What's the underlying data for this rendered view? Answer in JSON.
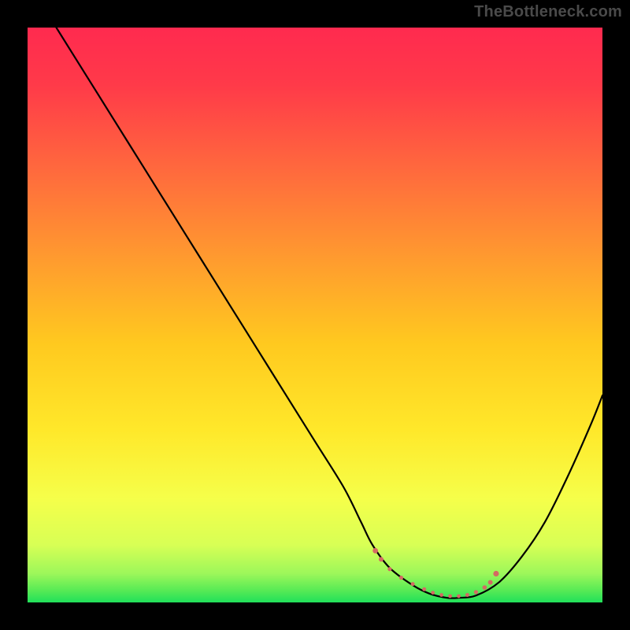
{
  "attribution": "TheBottleneck.com",
  "colors": {
    "frame_bg": "#000000",
    "gradient_top": "#ff2a4f",
    "gradient_mid": "#ffd400",
    "gradient_low": "#f7ff5a",
    "gradient_bottom": "#20e05a",
    "curve": "#000000",
    "marker": "#d46a63",
    "attribution_text": "#4a4a4a"
  },
  "chart_data": {
    "type": "line",
    "title": "",
    "xlabel": "",
    "ylabel": "",
    "xlim": [
      0,
      100
    ],
    "ylim": [
      0,
      100
    ],
    "grid": false,
    "legend": false,
    "series": [
      {
        "name": "bottleneck-curve",
        "x": [
          5,
          10,
          15,
          20,
          25,
          30,
          35,
          40,
          45,
          50,
          55,
          58,
          60,
          63,
          67,
          70,
          73,
          75,
          78,
          82,
          86,
          90,
          94,
          98,
          100
        ],
        "y": [
          100,
          92,
          84,
          76,
          68,
          60,
          52,
          44,
          36,
          28,
          20,
          14,
          10,
          6,
          3,
          1.5,
          0.8,
          0.8,
          1.2,
          3.5,
          8,
          14,
          22,
          31,
          36
        ]
      }
    ],
    "markers": [
      {
        "x": 60.5,
        "y": 9.0,
        "r": 3.4
      },
      {
        "x": 61.5,
        "y": 7.5,
        "r": 3.0
      },
      {
        "x": 63.0,
        "y": 5.8,
        "r": 2.6
      },
      {
        "x": 65.0,
        "y": 4.3,
        "r": 2.6
      },
      {
        "x": 67.0,
        "y": 3.2,
        "r": 2.5
      },
      {
        "x": 69.0,
        "y": 2.3,
        "r": 2.5
      },
      {
        "x": 70.5,
        "y": 1.7,
        "r": 2.4
      },
      {
        "x": 72.0,
        "y": 1.3,
        "r": 2.4
      },
      {
        "x": 73.5,
        "y": 1.1,
        "r": 2.4
      },
      {
        "x": 75.0,
        "y": 1.1,
        "r": 2.4
      },
      {
        "x": 76.5,
        "y": 1.3,
        "r": 2.5
      },
      {
        "x": 78.0,
        "y": 1.8,
        "r": 2.6
      },
      {
        "x": 79.5,
        "y": 2.6,
        "r": 2.8
      },
      {
        "x": 80.5,
        "y": 3.5,
        "r": 3.0
      },
      {
        "x": 81.5,
        "y": 5.0,
        "r": 3.6
      }
    ]
  }
}
